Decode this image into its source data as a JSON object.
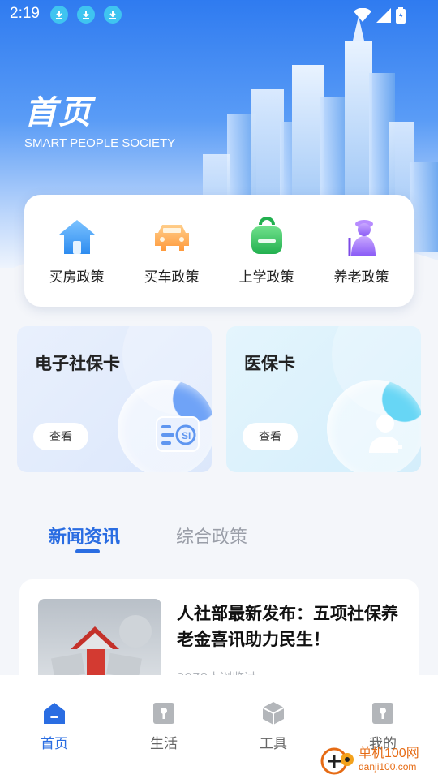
{
  "status_bar": {
    "time": "2:19"
  },
  "hero": {
    "title": "首页",
    "subtitle": "SMART PEOPLE SOCIETY"
  },
  "policies": [
    {
      "label": "买房政策",
      "icon": "house-icon"
    },
    {
      "label": "买车政策",
      "icon": "car-icon"
    },
    {
      "label": "上学政策",
      "icon": "backpack-icon"
    },
    {
      "label": "养老政策",
      "icon": "elderly-icon"
    }
  ],
  "cards": {
    "social_security": {
      "title": "电子社保卡",
      "button": "查看"
    },
    "medical": {
      "title": "医保卡",
      "button": "查看"
    }
  },
  "tabs": {
    "news": "新闻资讯",
    "policy": "综合政策"
  },
  "news": [
    {
      "title": "人社部最新发布：五项社保养老金喜讯助力民生！",
      "meta": "2978人浏览过"
    }
  ],
  "bottom_nav": [
    {
      "label": "首页"
    },
    {
      "label": "生活"
    },
    {
      "label": "工具"
    },
    {
      "label": "我的"
    }
  ],
  "watermark": {
    "name": "单机100网",
    "url": "danji100.com"
  },
  "colors": {
    "primary": "#2a6de2",
    "hero_blue": "#2f7bf0"
  }
}
